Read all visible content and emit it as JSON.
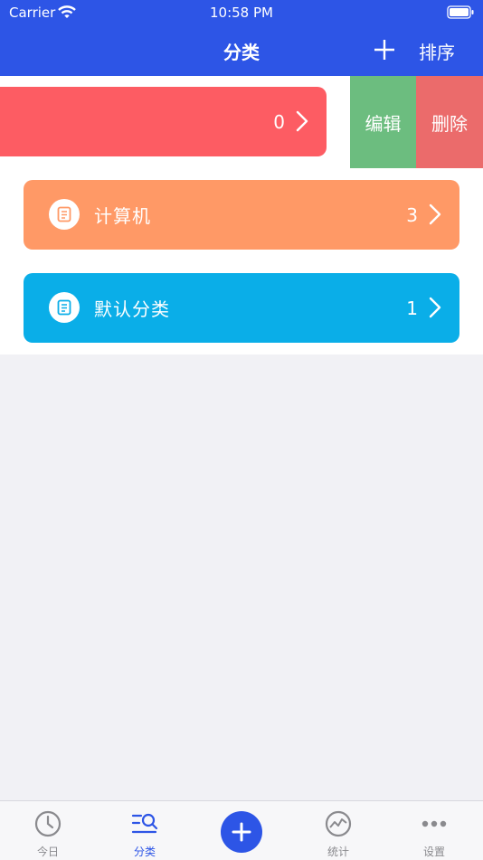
{
  "status_bar": {
    "carrier": "Carrier",
    "time": "10:58 PM"
  },
  "nav": {
    "title": "分类",
    "add_icon": "plus-icon",
    "sort_label": "排序"
  },
  "categories": [
    {
      "label": "",
      "count": "0",
      "color": "#fd5c63"
    },
    {
      "label": "计算机",
      "count": "3",
      "color": "#ff9966"
    },
    {
      "label": "默认分类",
      "count": "1",
      "color": "#0aaee8"
    }
  ],
  "swipe_actions": {
    "edit_label": "编辑",
    "edit_color": "#6cbd7f",
    "delete_label": "删除",
    "delete_color": "#eb6b6b"
  },
  "tabs": [
    {
      "label": "今日",
      "icon": "clock-icon"
    },
    {
      "label": "分类",
      "icon": "category-search-icon",
      "active": true
    },
    {
      "label": "",
      "icon": "add-icon"
    },
    {
      "label": "统计",
      "icon": "stats-icon"
    },
    {
      "label": "设置",
      "icon": "more-icon"
    }
  ],
  "colors": {
    "brand": "#2d55e6",
    "background": "#f1f1f5"
  }
}
